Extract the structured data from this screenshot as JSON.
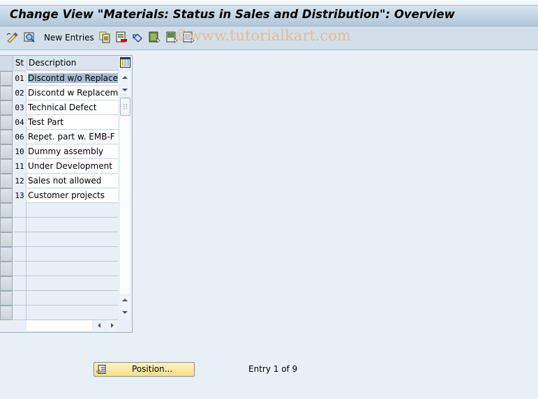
{
  "window": {
    "title": "Change View \"Materials: Status in Sales and Distribution\": Overview"
  },
  "toolbar": {
    "new_entries_label": "New Entries",
    "icons": [
      "display-change-icon",
      "details-icon",
      "copy-as-icon",
      "delete-icon",
      "undo-change-icon",
      "select-all-icon",
      "select-block-icon",
      "deselect-all-icon"
    ],
    "watermark": "©www.tutorialkart.com"
  },
  "table": {
    "columns": [
      "St",
      "Description"
    ],
    "rows": [
      {
        "st": "01",
        "description": "Discontd w/o Replace",
        "selected": true
      },
      {
        "st": "02",
        "description": "Discontd w Replacemt",
        "selected": false
      },
      {
        "st": "03",
        "description": "Technical Defect",
        "selected": false
      },
      {
        "st": "04",
        "description": "Test Part",
        "selected": false
      },
      {
        "st": "06",
        "description": "Repet. part w. EMB-F",
        "selected": false
      },
      {
        "st": "10",
        "description": "Dummy assembly",
        "selected": false
      },
      {
        "st": "11",
        "description": "Under Development",
        "selected": false
      },
      {
        "st": "12",
        "description": "Sales not allowed",
        "selected": false
      },
      {
        "st": "13",
        "description": "Customer projects",
        "selected": false
      }
    ],
    "empty_rows": 8
  },
  "footer": {
    "position_button_label": "Position...",
    "entry_status": "Entry 1 of 9"
  },
  "colors": {
    "accent_selected": "#a9bbd3",
    "button_yellow": "#f7e08a",
    "background": "#e8eff7"
  }
}
